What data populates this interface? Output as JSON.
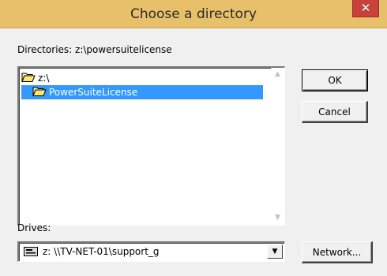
{
  "window": {
    "title": "Choose a directory",
    "close_glyph": "✕"
  },
  "directories": {
    "label": "Directories: z:\\powersuitelicense",
    "items": [
      {
        "label": "z:\\",
        "icon": "open-folder-icon",
        "selected": false
      },
      {
        "label": "PowerSuiteLicense",
        "icon": "open-folder-icon",
        "selected": true
      }
    ]
  },
  "buttons": {
    "ok": "OK",
    "cancel": "Cancel",
    "network": "Network..."
  },
  "drives": {
    "label": "Drives:",
    "selected": "z: \\\\TV-NET-01\\support_g",
    "icon": "network-drive-icon"
  },
  "colors": {
    "titlebar": "#e8c06a",
    "close_button": "#c7423b",
    "selection": "#3399ff",
    "dialog_bg": "#f0f0f0"
  }
}
